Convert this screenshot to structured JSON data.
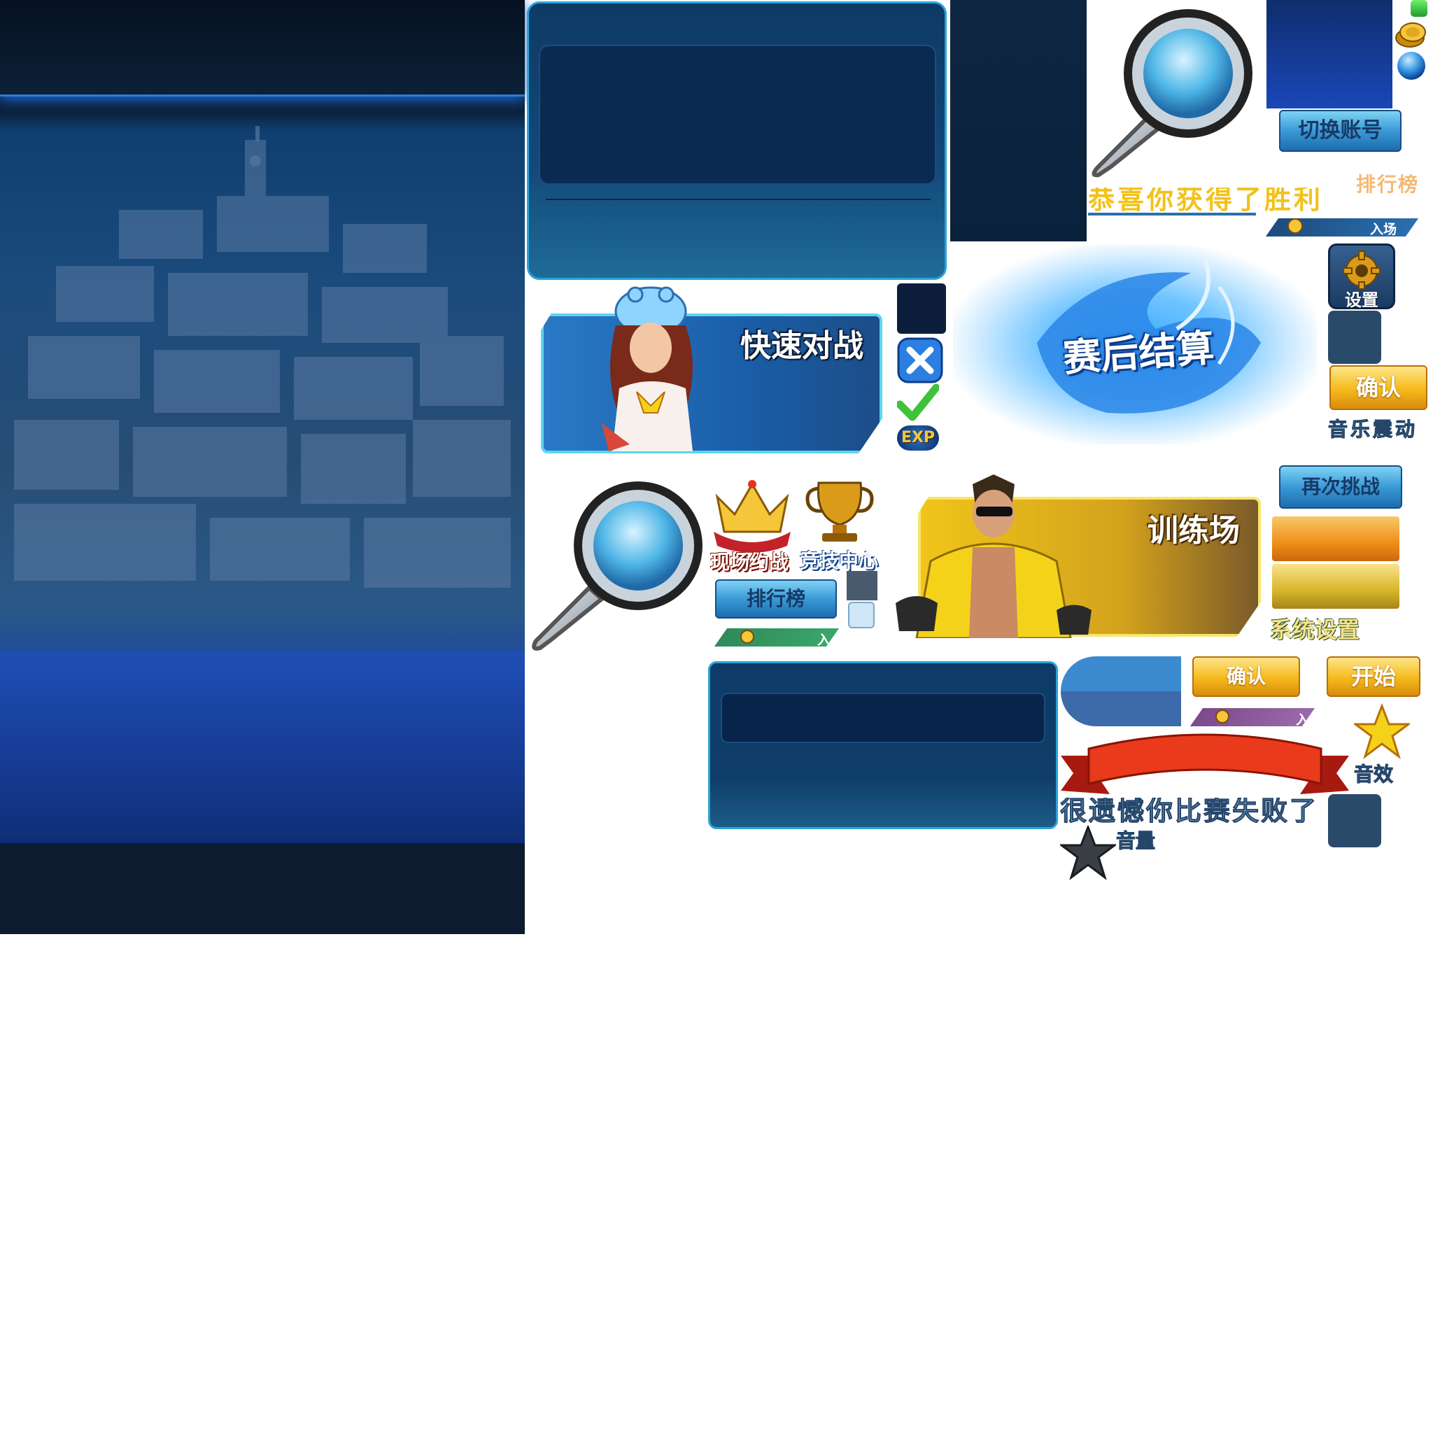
{
  "cards": {
    "quick_battle": "快速对战",
    "training": "训练场"
  },
  "buttons": {
    "switch_account": "切换账号",
    "leaderboard": "排行榜",
    "retry": "再次挑战",
    "confirm_1": "确认",
    "confirm_2": "确认",
    "start": "开始"
  },
  "labels": {
    "leaderboard_side": "排行榜",
    "settings": "设置",
    "post_match": "赛后结算",
    "music_vibration": "音乐震动",
    "live_match": "现场约战",
    "arena_center": "竞技中心",
    "system_settings": "系统设置",
    "sound_effects": "音效",
    "volume": "音量",
    "exp": "EXP",
    "victory_text_partial": "恭喜你获得了胜利",
    "defeat_text_partial": "很遗憾你比赛失败了"
  },
  "entry_bars": {
    "top_right": "入场",
    "mid_left": "入",
    "mid_right": "入"
  },
  "colors": {
    "panel_blue": "#0e3a66",
    "accent_cyan": "#2aa3d8",
    "gold": "#f5b91b",
    "ribbon_red": "#e8321a",
    "entry_green": "#2f8a5a",
    "entry_purple": "#7a4a8a",
    "entry_blue": "#2a6fb0"
  },
  "icons": [
    "magnifier-icon",
    "gold-coin-icon",
    "blue-orb-icon",
    "gear-icon",
    "close-icon",
    "check-icon",
    "crown-icon",
    "trophy-icon",
    "star-gold-icon",
    "star-dark-icon",
    "green-gem-icon"
  ]
}
